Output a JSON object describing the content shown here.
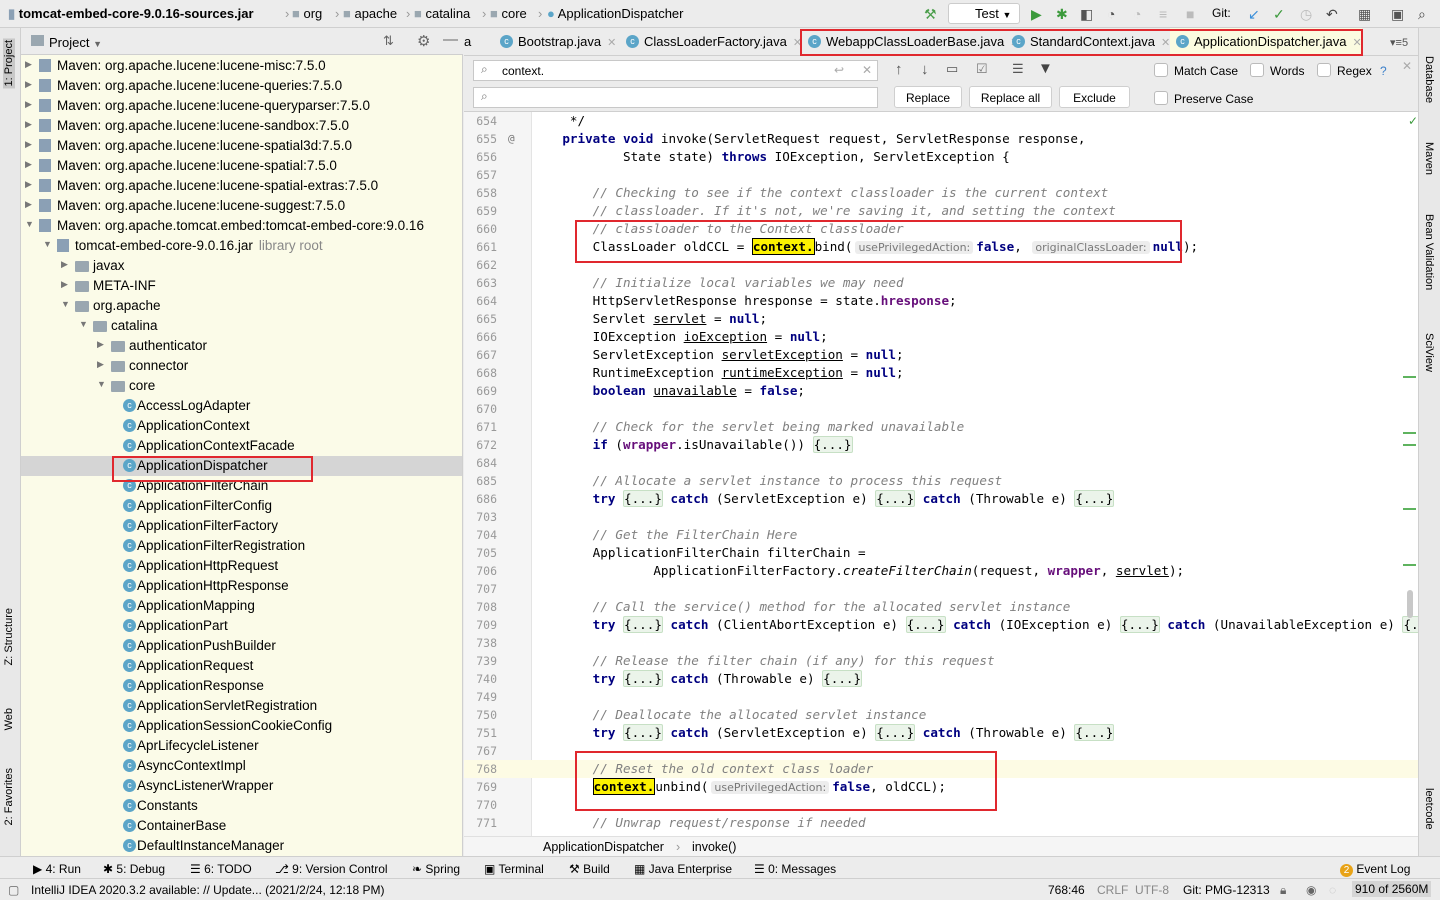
{
  "navbar": {
    "crumbs": [
      "tomcat-embed-core-9.0.16-sources.jar",
      "org",
      "apache",
      "catalina",
      "core",
      "ApplicationDispatcher"
    ],
    "run_config": "Test",
    "git_label": "Git:"
  },
  "left_strip": {
    "project": "1: Project",
    "structure": "Z: Structure",
    "web": "Web",
    "favorites": "2: Favorites"
  },
  "right_strip": {
    "database": "Database",
    "maven": "Maven",
    "bean_validation": "Bean Validation",
    "sciview": "SciView",
    "leetcode": "leetcode"
  },
  "project": {
    "title": "Project",
    "items": [
      {
        "label": "Maven: org.apache.lucene:lucene-misc:7.5.0",
        "depth": 0,
        "icon": "library",
        "state": "collapsed"
      },
      {
        "label": "Maven: org.apache.lucene:lucene-queries:7.5.0",
        "depth": 0,
        "icon": "library",
        "state": "collapsed"
      },
      {
        "label": "Maven: org.apache.lucene:lucene-queryparser:7.5.0",
        "depth": 0,
        "icon": "library",
        "state": "collapsed"
      },
      {
        "label": "Maven: org.apache.lucene:lucene-sandbox:7.5.0",
        "depth": 0,
        "icon": "library",
        "state": "collapsed"
      },
      {
        "label": "Maven: org.apache.lucene:lucene-spatial3d:7.5.0",
        "depth": 0,
        "icon": "library",
        "state": "collapsed"
      },
      {
        "label": "Maven: org.apache.lucene:lucene-spatial:7.5.0",
        "depth": 0,
        "icon": "library",
        "state": "collapsed"
      },
      {
        "label": "Maven: org.apache.lucene:lucene-spatial-extras:7.5.0",
        "depth": 0,
        "icon": "library",
        "state": "collapsed"
      },
      {
        "label": "Maven: org.apache.lucene:lucene-suggest:7.5.0",
        "depth": 0,
        "icon": "library",
        "state": "collapsed"
      },
      {
        "label": "Maven: org.apache.tomcat.embed:tomcat-embed-core:9.0.16",
        "depth": 0,
        "icon": "library",
        "state": "expanded"
      },
      {
        "label": "tomcat-embed-core-9.0.16.jar",
        "sub": "library root",
        "depth": 1,
        "icon": "jar",
        "state": "expanded"
      },
      {
        "label": "javax",
        "depth": 2,
        "icon": "folder",
        "state": "collapsed"
      },
      {
        "label": "META-INF",
        "depth": 2,
        "icon": "folder",
        "state": "collapsed"
      },
      {
        "label": "org.apache",
        "depth": 2,
        "icon": "folder",
        "state": "expanded"
      },
      {
        "label": "catalina",
        "depth": 3,
        "icon": "folder",
        "state": "expanded"
      },
      {
        "label": "authenticator",
        "depth": 4,
        "icon": "folder",
        "state": "collapsed"
      },
      {
        "label": "connector",
        "depth": 4,
        "icon": "folder",
        "state": "collapsed"
      },
      {
        "label": "core",
        "depth": 4,
        "icon": "folder",
        "state": "expanded"
      },
      {
        "label": "AccessLogAdapter",
        "depth": 5,
        "icon": "class"
      },
      {
        "label": "ApplicationContext",
        "depth": 5,
        "icon": "class"
      },
      {
        "label": "ApplicationContextFacade",
        "depth": 5,
        "icon": "class"
      },
      {
        "label": "ApplicationDispatcher",
        "depth": 5,
        "icon": "class",
        "selected": true
      },
      {
        "label": "ApplicationFilterChain",
        "depth": 5,
        "icon": "class"
      },
      {
        "label": "ApplicationFilterConfig",
        "depth": 5,
        "icon": "class"
      },
      {
        "label": "ApplicationFilterFactory",
        "depth": 5,
        "icon": "class"
      },
      {
        "label": "ApplicationFilterRegistration",
        "depth": 5,
        "icon": "class"
      },
      {
        "label": "ApplicationHttpRequest",
        "depth": 5,
        "icon": "class"
      },
      {
        "label": "ApplicationHttpResponse",
        "depth": 5,
        "icon": "class"
      },
      {
        "label": "ApplicationMapping",
        "depth": 5,
        "icon": "class"
      },
      {
        "label": "ApplicationPart",
        "depth": 5,
        "icon": "class"
      },
      {
        "label": "ApplicationPushBuilder",
        "depth": 5,
        "icon": "class"
      },
      {
        "label": "ApplicationRequest",
        "depth": 5,
        "icon": "class"
      },
      {
        "label": "ApplicationResponse",
        "depth": 5,
        "icon": "class"
      },
      {
        "label": "ApplicationServletRegistration",
        "depth": 5,
        "icon": "class"
      },
      {
        "label": "ApplicationSessionCookieConfig",
        "depth": 5,
        "icon": "class"
      },
      {
        "label": "AprLifecycleListener",
        "depth": 5,
        "icon": "class"
      },
      {
        "label": "AsyncContextImpl",
        "depth": 5,
        "icon": "class"
      },
      {
        "label": "AsyncListenerWrapper",
        "depth": 5,
        "icon": "class"
      },
      {
        "label": "Constants",
        "depth": 5,
        "icon": "class"
      },
      {
        "label": "ContainerBase",
        "depth": 5,
        "icon": "class"
      },
      {
        "label": "DefaultInstanceManager",
        "depth": 5,
        "icon": "class"
      }
    ]
  },
  "tabs": [
    {
      "label": "a",
      "active": false
    },
    {
      "label": "Bootstrap.java",
      "active": false
    },
    {
      "label": "ClassLoaderFactory.java",
      "active": false
    },
    {
      "label": "WebappClassLoaderBase.java",
      "active": false
    },
    {
      "label": "StandardContext.java",
      "active": false
    },
    {
      "label": "ApplicationDispatcher.java",
      "active": true
    }
  ],
  "tabs_overflow": "5",
  "find": {
    "search_value": "context.",
    "replace_value": "",
    "replace": "Replace",
    "replace_all": "Replace all",
    "exclude": "Exclude",
    "match_case": "Match Case",
    "words": "Words",
    "regex": "Regex",
    "help": "?",
    "preserve_case": "Preserve Case"
  },
  "code": [
    {
      "n": "654",
      "s": [
        [
          "t",
          "     */"
        ]
      ]
    },
    {
      "n": "655",
      "s": [
        [
          "t",
          "    "
        ],
        [
          "k",
          "private void "
        ],
        [
          "t",
          "invoke(ServletRequest request, ServletResponse response,"
        ]
      ]
    },
    {
      "n": "656",
      "s": [
        [
          "t",
          "            State state) "
        ],
        [
          "k",
          "throws "
        ],
        [
          "t",
          "IOException, ServletException {"
        ]
      ]
    },
    {
      "n": "657",
      "s": []
    },
    {
      "n": "658",
      "s": [
        [
          "t",
          "        "
        ],
        [
          "c",
          "// Checking to see if the context classloader is the current context"
        ]
      ]
    },
    {
      "n": "659",
      "s": [
        [
          "t",
          "        "
        ],
        [
          "c",
          "// classloader. If it's not, we're saving it, and setting the context"
        ]
      ]
    },
    {
      "n": "660",
      "s": [
        [
          "t",
          "        "
        ],
        [
          "c",
          "// classloader to the Context classloader"
        ]
      ]
    },
    {
      "n": "661",
      "s": [
        [
          "t",
          "        ClassLoader oldCCL = "
        ],
        [
          "h",
          "context."
        ],
        [
          "t",
          "bind("
        ],
        [
          "p",
          "usePrivilegedAction:"
        ],
        [
          "k",
          "false"
        ],
        [
          "t",
          ", "
        ],
        [
          "p",
          "originalClassLoader:"
        ],
        [
          "k",
          "null"
        ],
        [
          "t",
          ");"
        ]
      ]
    },
    {
      "n": "662",
      "s": []
    },
    {
      "n": "663",
      "s": [
        [
          "t",
          "        "
        ],
        [
          "c",
          "// Initialize local variables we may need"
        ]
      ]
    },
    {
      "n": "664",
      "s": [
        [
          "t",
          "        HttpServletResponse hresponse = state."
        ],
        [
          "pf",
          "hresponse"
        ],
        [
          "t",
          ";"
        ]
      ]
    },
    {
      "n": "665",
      "s": [
        [
          "t",
          "        Servlet "
        ],
        [
          "u",
          "servlet"
        ],
        [
          "t",
          " = "
        ],
        [
          "k",
          "null"
        ],
        [
          "t",
          ";"
        ]
      ]
    },
    {
      "n": "666",
      "s": [
        [
          "t",
          "        IOException "
        ],
        [
          "u",
          "ioException"
        ],
        [
          "t",
          " = "
        ],
        [
          "k",
          "null"
        ],
        [
          "t",
          ";"
        ]
      ]
    },
    {
      "n": "667",
      "s": [
        [
          "t",
          "        ServletException "
        ],
        [
          "u",
          "servletException"
        ],
        [
          "t",
          " = "
        ],
        [
          "k",
          "null"
        ],
        [
          "t",
          ";"
        ]
      ]
    },
    {
      "n": "668",
      "s": [
        [
          "t",
          "        RuntimeException "
        ],
        [
          "u",
          "runtimeException"
        ],
        [
          "t",
          " = "
        ],
        [
          "k",
          "null"
        ],
        [
          "t",
          ";"
        ]
      ]
    },
    {
      "n": "669",
      "s": [
        [
          "t",
          "        "
        ],
        [
          "k",
          "boolean "
        ],
        [
          "u",
          "unavailable"
        ],
        [
          "t",
          " = "
        ],
        [
          "k",
          "false"
        ],
        [
          "t",
          ";"
        ]
      ]
    },
    {
      "n": "670",
      "s": []
    },
    {
      "n": "671",
      "s": [
        [
          "t",
          "        "
        ],
        [
          "c",
          "// Check for the servlet being marked unavailable"
        ]
      ]
    },
    {
      "n": "672",
      "s": [
        [
          "t",
          "        "
        ],
        [
          "k",
          "if "
        ],
        [
          "t",
          "("
        ],
        [
          "pf",
          "wrapper"
        ],
        [
          "t",
          ".isUnavailable()) "
        ],
        [
          "f",
          "{...}"
        ]
      ]
    },
    {
      "n": "684",
      "s": []
    },
    {
      "n": "685",
      "s": [
        [
          "t",
          "        "
        ],
        [
          "c",
          "// Allocate a servlet instance to process this request"
        ]
      ]
    },
    {
      "n": "686",
      "s": [
        [
          "t",
          "        "
        ],
        [
          "k",
          "try "
        ],
        [
          "f",
          "{...}"
        ],
        [
          "k",
          " catch "
        ],
        [
          "t",
          "(ServletException e) "
        ],
        [
          "f",
          "{...}"
        ],
        [
          "k",
          " catch "
        ],
        [
          "t",
          "(Throwable e) "
        ],
        [
          "f",
          "{...}"
        ]
      ]
    },
    {
      "n": "703",
      "s": []
    },
    {
      "n": "704",
      "s": [
        [
          "t",
          "        "
        ],
        [
          "c",
          "// Get the FilterChain Here"
        ]
      ]
    },
    {
      "n": "705",
      "s": [
        [
          "t",
          "        ApplicationFilterChain filterChain ="
        ]
      ]
    },
    {
      "n": "706",
      "s": [
        [
          "t",
          "                ApplicationFilterFactory."
        ],
        [
          "i",
          "createFilterChain"
        ],
        [
          "t",
          "(request, "
        ],
        [
          "pf",
          "wrapper"
        ],
        [
          "t",
          ", "
        ],
        [
          "u",
          "servlet"
        ],
        [
          "t",
          ");"
        ]
      ]
    },
    {
      "n": "707",
      "s": []
    },
    {
      "n": "708",
      "s": [
        [
          "t",
          "        "
        ],
        [
          "c",
          "// Call the service() method for the allocated servlet instance"
        ]
      ]
    },
    {
      "n": "709",
      "s": [
        [
          "t",
          "        "
        ],
        [
          "k",
          "try "
        ],
        [
          "f",
          "{...}"
        ],
        [
          "k",
          " catch "
        ],
        [
          "t",
          "(ClientAbortException e) "
        ],
        [
          "f",
          "{...}"
        ],
        [
          "k",
          " catch "
        ],
        [
          "t",
          "(IOException e) "
        ],
        [
          "f",
          "{...}"
        ],
        [
          "k",
          " catch "
        ],
        [
          "t",
          "(UnavailableException e) "
        ],
        [
          "f",
          "{...}"
        ],
        [
          "k",
          " catch"
        ]
      ]
    },
    {
      "n": "738",
      "s": []
    },
    {
      "n": "739",
      "s": [
        [
          "t",
          "        "
        ],
        [
          "c",
          "// Release the filter chain (if any) for this request"
        ]
      ]
    },
    {
      "n": "740",
      "s": [
        [
          "t",
          "        "
        ],
        [
          "k",
          "try "
        ],
        [
          "f",
          "{...}"
        ],
        [
          "k",
          " catch "
        ],
        [
          "t",
          "(Throwable e) "
        ],
        [
          "f",
          "{...}"
        ]
      ]
    },
    {
      "n": "749",
      "s": []
    },
    {
      "n": "750",
      "s": [
        [
          "t",
          "        "
        ],
        [
          "c",
          "// Deallocate the allocated servlet instance"
        ]
      ]
    },
    {
      "n": "751",
      "s": [
        [
          "t",
          "        "
        ],
        [
          "k",
          "try "
        ],
        [
          "f",
          "{...}"
        ],
        [
          "k",
          " catch "
        ],
        [
          "t",
          "(ServletException e) "
        ],
        [
          "f",
          "{...}"
        ],
        [
          "k",
          " catch "
        ],
        [
          "t",
          "(Throwable e) "
        ],
        [
          "f",
          "{...}"
        ]
      ]
    },
    {
      "n": "767",
      "s": []
    },
    {
      "n": "768",
      "s": [
        [
          "t",
          "        "
        ],
        [
          "c",
          "// Reset the old context class loader"
        ]
      ],
      "current": true
    },
    {
      "n": "769",
      "s": [
        [
          "t",
          "        "
        ],
        [
          "h",
          "context."
        ],
        [
          "t",
          "unbind("
        ],
        [
          "p",
          "usePrivilegedAction:"
        ],
        [
          "k",
          "false"
        ],
        [
          "t",
          ", oldCCL);"
        ]
      ]
    },
    {
      "n": "770",
      "s": []
    },
    {
      "n": "771",
      "s": [
        [
          "t",
          "        "
        ],
        [
          "c",
          "// Unwrap request/response if needed"
        ]
      ]
    }
  ],
  "editor_breadcrumb": [
    "ApplicationDispatcher",
    "invoke()"
  ],
  "tool_windows": [
    "4: Run",
    "5: Debug",
    "6: TODO",
    "9: Version Control",
    "Spring",
    "Terminal",
    "Build",
    "Java Enterprise",
    "0: Messages"
  ],
  "event_log": {
    "count": "2",
    "label": "Event Log"
  },
  "status": {
    "message": "IntelliJ IDEA 2020.3.2 available: // Update... (2021/2/24, 12:18 PM)",
    "position": "768:46",
    "line_sep": "CRLF",
    "encoding": "UTF-8",
    "git_branch": "Git: PMG-12313",
    "memory": "910 of 2560M"
  },
  "colors": {
    "highlight": "#fcf200",
    "red_box": "#e0282e",
    "keyword": "#000080",
    "comment": "#808080",
    "field": "#660e7a"
  }
}
